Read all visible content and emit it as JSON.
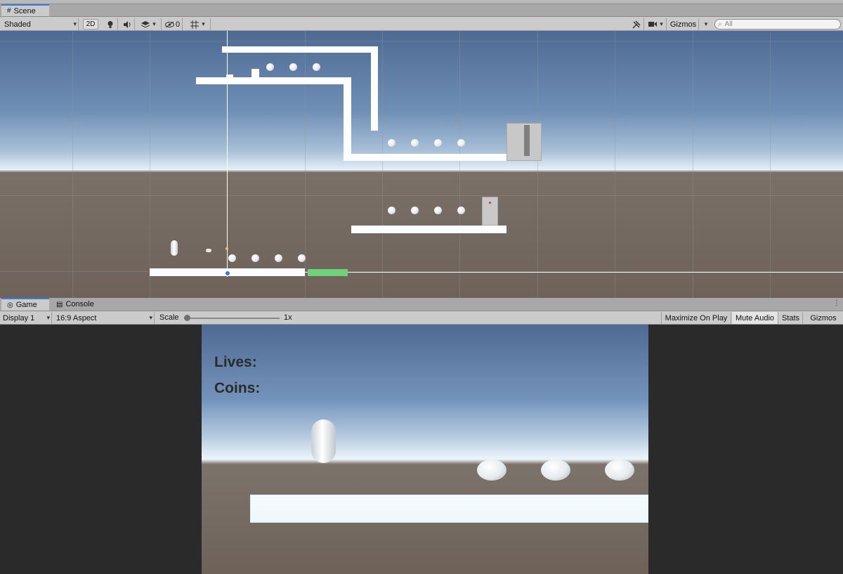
{
  "top_strip": {},
  "scene_tab": {
    "label": "Scene"
  },
  "scene_toolbar": {
    "draw_mode": "Shaded",
    "mode_2d": "2D",
    "hidden_count": "0",
    "gizmos": "Gizmos",
    "search_placeholder": "All"
  },
  "lower_tabs": [
    {
      "label": "Game",
      "icon": "gamepad-icon"
    },
    {
      "label": "Console",
      "icon": "console-icon"
    }
  ],
  "game_toolbar": {
    "display": "Display 1",
    "aspect": "16:9 Aspect",
    "scale_label": "Scale",
    "scale_value": "1x",
    "scale_fraction": 0.0,
    "maximize_on_play": "Maximize On Play",
    "mute_audio": "Mute Audio",
    "stats": "Stats",
    "gizmos": "Gizmos"
  },
  "game_hud": {
    "lives": "Lives:",
    "coins": "Coins:"
  },
  "colors": {
    "accent": "#3a7bd5",
    "goal_platform": "#6fd17a"
  }
}
